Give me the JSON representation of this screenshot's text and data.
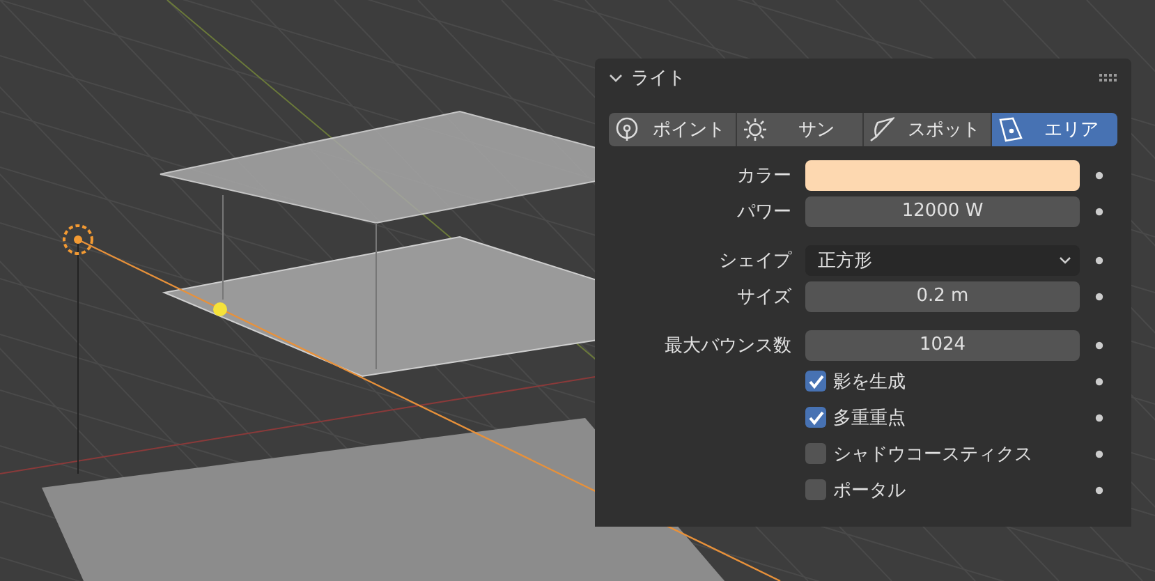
{
  "panel": {
    "title": "ライト",
    "expanded": true
  },
  "tabs": [
    {
      "label": "ポイント",
      "kind": "point",
      "selected": false
    },
    {
      "label": "サン",
      "kind": "sun",
      "selected": false
    },
    {
      "label": "スポット",
      "kind": "spot",
      "selected": false
    },
    {
      "label": "エリア",
      "kind": "area",
      "selected": true
    }
  ],
  "groups": [
    [
      {
        "kind": "color",
        "label": "カラー",
        "color": "#fdd8b0"
      },
      {
        "kind": "number",
        "label": "パワー",
        "value": "12000 W"
      }
    ],
    [
      {
        "kind": "dropdown",
        "label": "シェイプ",
        "value": "正方形"
      },
      {
        "kind": "number",
        "label": "サイズ",
        "value": "0.2 m"
      }
    ],
    [
      {
        "kind": "number",
        "label": "最大バウンス数",
        "value": "1024"
      },
      {
        "kind": "checkbox",
        "label": "影を生成",
        "checked": true
      },
      {
        "kind": "checkbox",
        "label": "多重重点",
        "checked": true
      },
      {
        "kind": "checkbox",
        "label": "シャドウコースティクス",
        "checked": false
      },
      {
        "kind": "checkbox",
        "label": "ポータル",
        "checked": false
      }
    ]
  ]
}
